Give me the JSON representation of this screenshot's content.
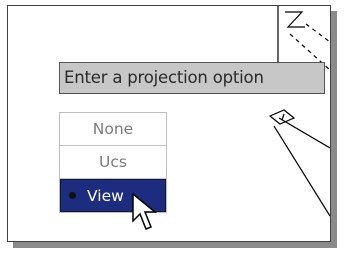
{
  "tooltip": {
    "text": "Enter a projection option"
  },
  "menu": {
    "options": [
      {
        "label": "None",
        "selected": false
      },
      {
        "label": "Ucs",
        "selected": false
      },
      {
        "label": "View",
        "selected": true
      }
    ]
  },
  "colors": {
    "tooltip_bg": "#c7c7c7",
    "selected_bg": "#1c2c7e",
    "option_text": "#7a7a7a",
    "drawing_lines": "#000000"
  },
  "icons": {
    "cursor": "arrow-pointer-icon",
    "bullet": "bullet-icon"
  }
}
